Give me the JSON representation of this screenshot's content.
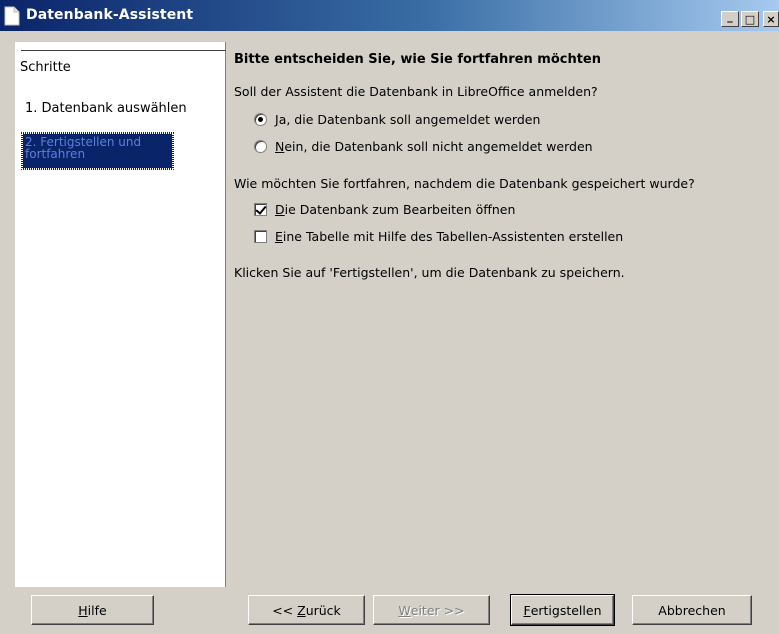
{
  "window": {
    "title": "Datenbank-Assistent",
    "minimize_glyph": "_",
    "maximize_glyph": "□",
    "close_glyph": "×"
  },
  "steps": {
    "heading": "Schritte",
    "items": [
      {
        "label": "1. Datenbank auswählen",
        "active": false
      },
      {
        "label": "2. Fertigstellen und fortfahren",
        "active": true
      }
    ]
  },
  "content": {
    "heading": "Bitte entscheiden Sie, wie Sie fortfahren möchten",
    "register_question": "Soll der Assistent die Datenbank in LibreOffice anmelden?",
    "register_options": [
      {
        "accel": "J",
        "rest": "a, die Datenbank soll angemeldet werden",
        "checked": true
      },
      {
        "accel": "N",
        "rest": "ein, die Datenbank soll nicht angemeldet werden",
        "checked": false
      }
    ],
    "after_question": "Wie möchten Sie fortfahren, nachdem die Datenbank gespeichert wurde?",
    "after_options": [
      {
        "accel": "D",
        "rest": "ie Datenbank zum Bearbeiten öffnen",
        "checked": true
      },
      {
        "accel": "E",
        "rest": "ine Tabelle mit Hilfe des Tabellen-Assistenten erstellen",
        "checked": false
      }
    ],
    "finish_hint": "Klicken Sie auf 'Fertigstellen', um die Datenbank zu speichern."
  },
  "buttons": {
    "help": {
      "accel": "H",
      "rest": "ilfe"
    },
    "back": {
      "pre": "<< ",
      "accel": "Z",
      "rest": "urück"
    },
    "next": {
      "accel": "W",
      "rest": "eiter >>",
      "enabled": false
    },
    "finish": {
      "accel": "F",
      "rest": "ertigstellen"
    },
    "cancel": {
      "label": "Abbrechen"
    }
  }
}
